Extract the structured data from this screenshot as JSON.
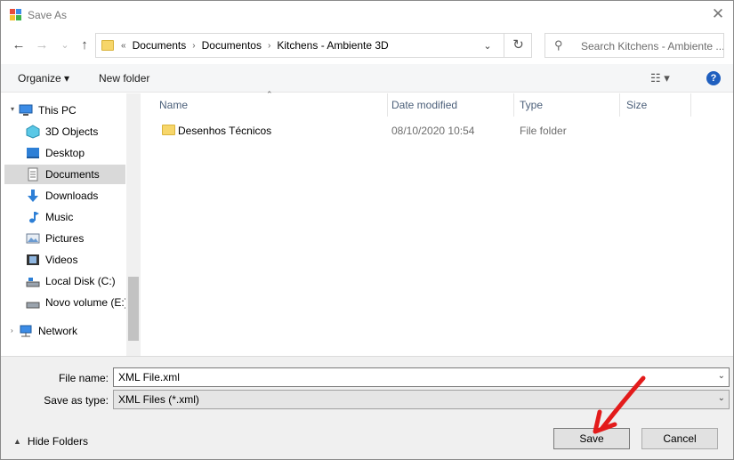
{
  "window": {
    "title": "Save As",
    "close_glyph": "✕"
  },
  "nav": {
    "back_icon": "←",
    "forward_icon": "→",
    "recent_icon": "⌄",
    "up_icon": "↑",
    "breadcrumb_prefix": "«",
    "breadcrumbs": [
      "Documents",
      "Documentos",
      "Kitchens - Ambiente 3D"
    ],
    "dropdown_icon": "⌄",
    "refresh_icon": "↻",
    "search_placeholder": "Search Kitchens - Ambiente ..."
  },
  "toolbar": {
    "organize": "Organize ▾",
    "new_folder": "New folder",
    "view_icon": "☷ ▾",
    "help": "?"
  },
  "sidebar": {
    "items": [
      {
        "label": "This PC",
        "icon": "computer-icon"
      },
      {
        "label": "3D Objects",
        "icon": "3d-objects-icon"
      },
      {
        "label": "Desktop",
        "icon": "desktop-icon"
      },
      {
        "label": "Documents",
        "icon": "documents-icon",
        "selected": true
      },
      {
        "label": "Downloads",
        "icon": "downloads-icon"
      },
      {
        "label": "Music",
        "icon": "music-icon"
      },
      {
        "label": "Pictures",
        "icon": "pictures-icon"
      },
      {
        "label": "Videos",
        "icon": "videos-icon"
      },
      {
        "label": "Local Disk (C:)",
        "icon": "local-disk-icon"
      },
      {
        "label": "Novo volume (E:)",
        "icon": "drive-icon"
      },
      {
        "label": "Network",
        "icon": "network-icon"
      }
    ]
  },
  "file_list": {
    "columns": [
      "Name",
      "Date modified",
      "Type",
      "Size"
    ],
    "rows": [
      {
        "name": "Desenhos Técnicos",
        "date": "08/10/2020 10:54",
        "type": "File folder",
        "size": ""
      }
    ]
  },
  "form": {
    "file_name_label": "File name:",
    "file_name_value": "XML File.xml",
    "save_type_label": "Save as type:",
    "save_type_value": "XML Files (*.xml)",
    "hide_folders": "Hide Folders",
    "save_button": "Save",
    "cancel_button": "Cancel"
  },
  "colors": {
    "accent": "#1f5fbf",
    "annotation": "#e31b1b",
    "folder": "#f7d66a"
  }
}
